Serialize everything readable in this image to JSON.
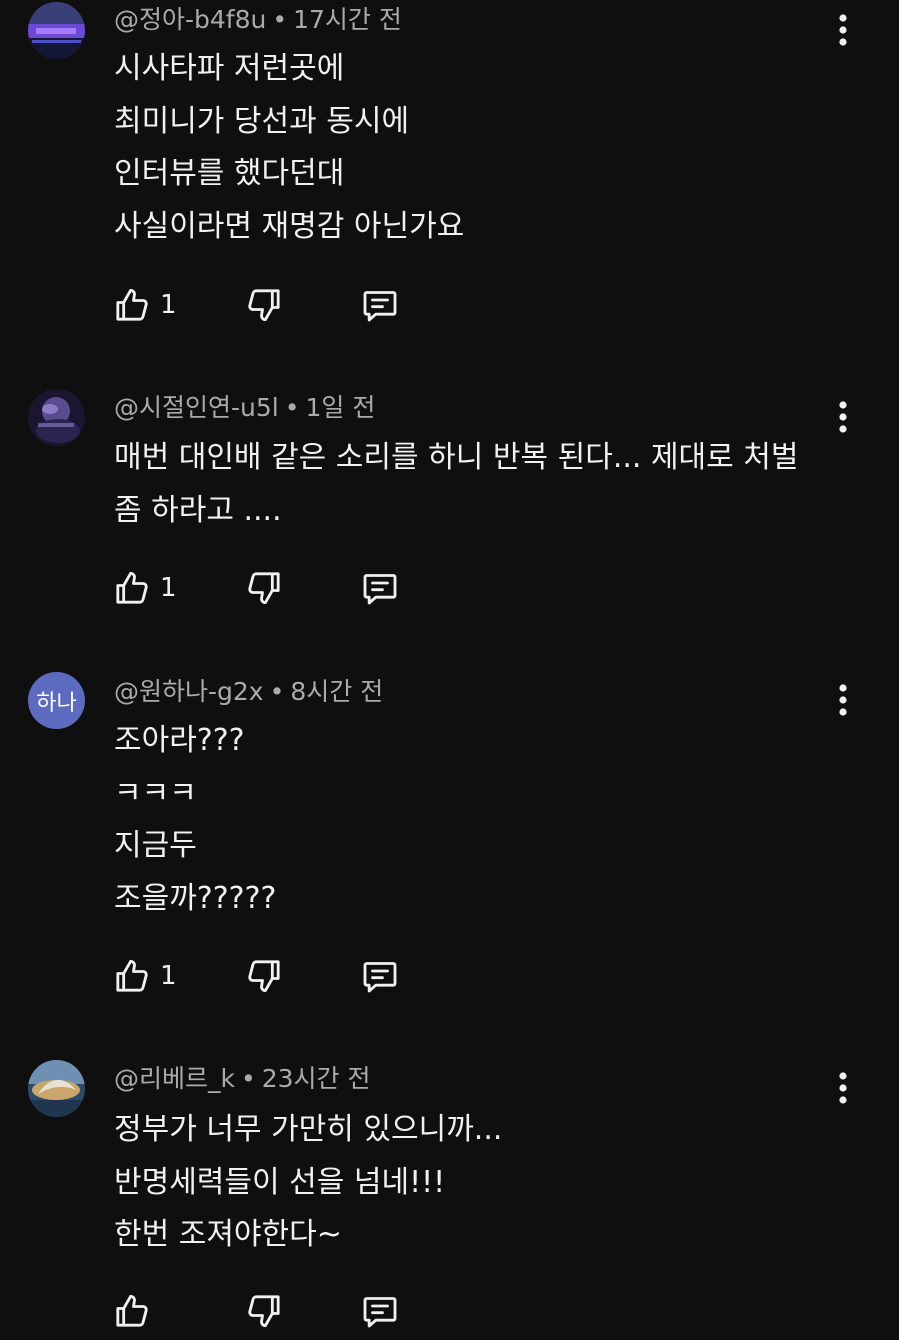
{
  "colors": {
    "background": "#0f0f0f",
    "text_primary": "#f1f1f1",
    "text_secondary": "#aaaaaa",
    "avatar_purple": "#5c6bc0"
  },
  "icons": {
    "like": "thumbs-up-icon",
    "dislike": "thumbs-down-icon",
    "reply": "comment-reply-icon",
    "more": "more-vertical-icon"
  },
  "comments": [
    {
      "author": "@정아-b4f8u",
      "separator": "•",
      "time": "17시간 전",
      "lines": [
        "시사타파 저런곳에",
        "최미니가 당선과 동시에",
        "인터뷰를 했다던대",
        "사실이라면 재명감 아닌가요"
      ],
      "likes": "1"
    },
    {
      "author": "@시절인연-u5l",
      "separator": "•",
      "time": "1일 전",
      "lines": [
        "매번 대인배 같은 소리를 하니 반복 된다... 제대로 처벌",
        "좀 하라고 ...."
      ],
      "likes": "1"
    },
    {
      "author": "@원하나-g2x",
      "separator": "•",
      "time": "8시간 전",
      "avatar_text": "하나",
      "lines": [
        "조아라???",
        "ㅋㅋㅋ",
        "지금두",
        "조을까?????"
      ],
      "likes": "1"
    },
    {
      "author": "@리베르_k",
      "separator": "•",
      "time": "23시간 전",
      "lines": [
        "정부가 너무 가만히 있으니까...",
        "반명세력들이 선을 넘네!!!",
        "한번 조져야한다~"
      ],
      "likes": ""
    }
  ]
}
